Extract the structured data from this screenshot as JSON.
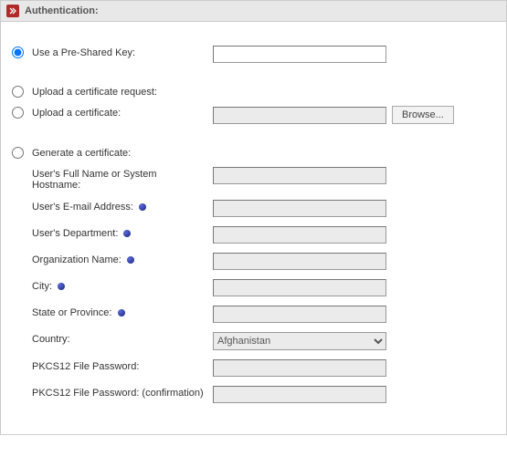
{
  "header": {
    "title": "Authentication:"
  },
  "options": {
    "psk": {
      "label": "Use a Pre-Shared Key:",
      "value": ""
    },
    "upload_req": {
      "label": "Upload a certificate request:"
    },
    "upload_cert": {
      "label": "Upload a certificate:",
      "value": "",
      "browse_label": "Browse..."
    },
    "generate": {
      "label": "Generate a certificate:"
    }
  },
  "gen": {
    "full_name": {
      "label": "User's Full Name or System Hostname:",
      "value": ""
    },
    "email": {
      "label": "User's E-mail Address:",
      "value": ""
    },
    "department": {
      "label": "User's Department:",
      "value": ""
    },
    "org": {
      "label": "Organization Name:",
      "value": ""
    },
    "city": {
      "label": "City:",
      "value": ""
    },
    "state": {
      "label": "State or Province:",
      "value": ""
    },
    "country": {
      "label": "Country:",
      "selected": "Afghanistan"
    },
    "pkcs12_pw": {
      "label": "PKCS12 File Password:",
      "value": ""
    },
    "pkcs12_pw_confirm": {
      "label": "PKCS12 File Password: (confirmation)",
      "value": ""
    }
  }
}
